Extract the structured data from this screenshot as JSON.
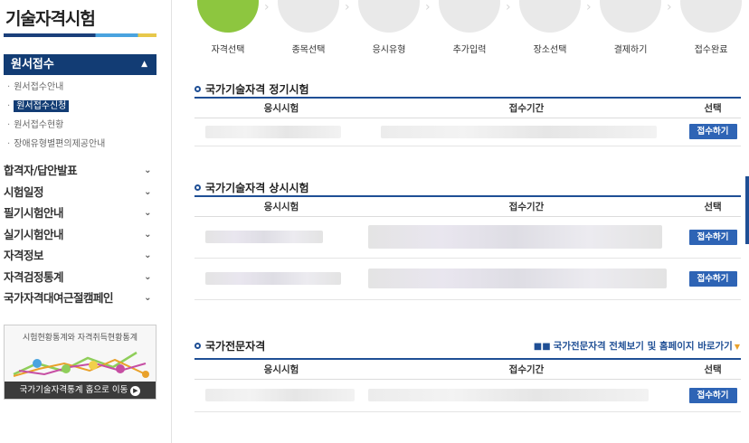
{
  "sidebar": {
    "title": "기술자격시험",
    "active_menu": "원서접수",
    "submenu": [
      "원서접수안내",
      "원서접수신청",
      "원서접수현황",
      "장애유형별편의제공안내"
    ],
    "current_submenu_index": 1,
    "menu": [
      "합격자/답안발표",
      "시험일정",
      "필기시험안내",
      "실기시험안내",
      "자격정보",
      "자격검정통계",
      "국가자격대여근절캠페인"
    ],
    "stats_box": {
      "text": "시험현황통계와 자격취득현황통계",
      "button_label": "국가기술자격통계 홈으로 이동"
    }
  },
  "steps": [
    "자격선택",
    "종목선택",
    "응시유형",
    "추가입력",
    "장소선택",
    "결제하기",
    "접수완료"
  ],
  "sections": [
    {
      "title": "국가기술자격 정기시험",
      "headers": [
        "응시시험",
        "접수기간",
        "선택"
      ],
      "rows": [
        {
          "button": "접수하기"
        }
      ]
    },
    {
      "title": "국가기술자격 상시시험",
      "headers": [
        "응시시험",
        "접수기간",
        "선택"
      ],
      "rows": [
        {
          "button": "접수하기"
        },
        {
          "button": "접수하기"
        }
      ]
    },
    {
      "title": "국가전문자격",
      "link": "국가전문자격 전체보기 및 홈페이지 바로가기",
      "headers": [
        "응시시험",
        "접수기간",
        "선택"
      ],
      "rows": [
        {
          "button": "접수하기"
        }
      ]
    }
  ],
  "colors": {
    "primary": "#123c74",
    "accent_button": "#2e64b5",
    "step_done": "#8dc63f"
  }
}
